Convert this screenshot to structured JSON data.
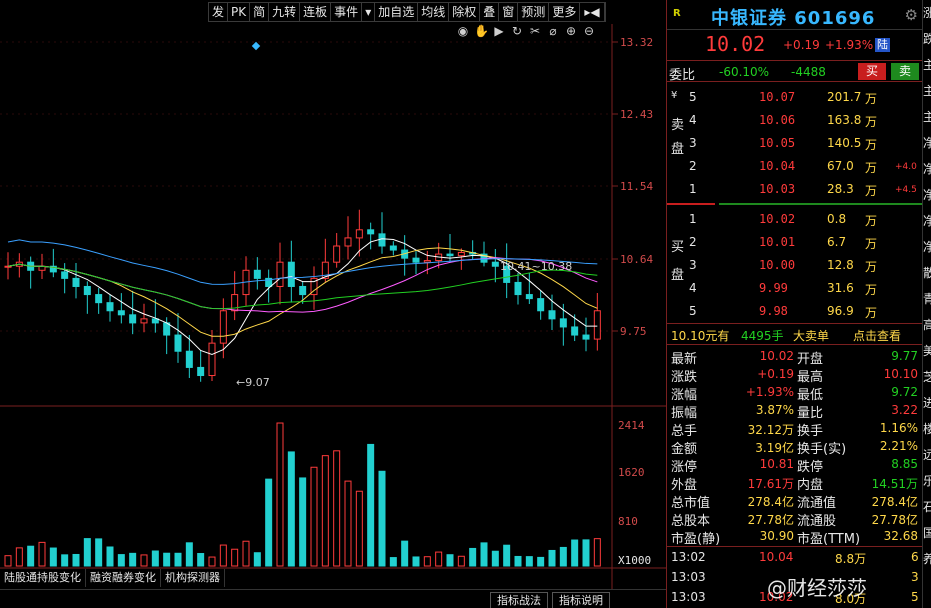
{
  "toolbar": [
    "发",
    "PK",
    "简",
    "九转",
    "连板",
    "事件",
    "▾",
    "加自选",
    "均线",
    "除权",
    "叠",
    "窗",
    "预测",
    "更多",
    "▸◀"
  ],
  "chart": {
    "price_labels": [
      "13.32",
      "12.43",
      "11.54",
      "10.64",
      "9.75"
    ],
    "volume_labels": [
      "2414",
      "1620",
      "810",
      "X1000"
    ],
    "low_annotation": "9.07",
    "range_annotation": "10.41~10.38"
  },
  "bottom_tabs": [
    "陆股通持股变化",
    "融资融券变化",
    "机构探测器"
  ],
  "bottom_buttons": [
    "指标战法",
    "指标说明"
  ],
  "stock": {
    "badge": "R",
    "title": "中银证券 601696",
    "price": "10.02",
    "change": "+0.19",
    "change_pct": "+1.93%",
    "market_tag": "陆",
    "weibi_label": "委比",
    "weibi": "-60.10%",
    "weicha": "-4488",
    "buy_label": "买",
    "sell_label": "卖"
  },
  "asks": [
    {
      "lvl": "5",
      "price": "10.07",
      "qty": "201.7",
      "unit": "万",
      "delta": ""
    },
    {
      "lvl": "4",
      "price": "10.06",
      "qty": "163.8",
      "unit": "万",
      "delta": ""
    },
    {
      "lvl": "3",
      "price": "10.05",
      "qty": "140.5",
      "unit": "万",
      "delta": ""
    },
    {
      "lvl": "2",
      "price": "10.04",
      "qty": "67.0",
      "unit": "万",
      "delta": "+4.0"
    },
    {
      "lvl": "1",
      "price": "10.03",
      "qty": "28.3",
      "unit": "万",
      "delta": "+4.5"
    }
  ],
  "ask_side": [
    "¥",
    "卖",
    "盘"
  ],
  "bids": [
    {
      "lvl": "1",
      "price": "10.02",
      "qty": "0.8",
      "unit": "万"
    },
    {
      "lvl": "2",
      "price": "10.01",
      "qty": "6.7",
      "unit": "万"
    },
    {
      "lvl": "3",
      "price": "10.00",
      "qty": "12.8",
      "unit": "万"
    },
    {
      "lvl": "4",
      "price": "9.99",
      "qty": "31.6",
      "unit": "万"
    },
    {
      "lvl": "5",
      "price": "9.98",
      "qty": "96.9",
      "unit": "万"
    }
  ],
  "bid_side": [
    "买",
    "盘"
  ],
  "summary": {
    "a": "10.10元有",
    "b": "4495手",
    "c": "大卖单",
    "d": "点击查看"
  },
  "stats": [
    {
      "k1": "最新",
      "v1": "10.02",
      "c1": "red",
      "k2": "开盘",
      "v2": "9.77",
      "c2": "green"
    },
    {
      "k1": "涨跌",
      "v1": "+0.19",
      "c1": "red",
      "k2": "最高",
      "v2": "10.10",
      "c2": "red"
    },
    {
      "k1": "涨幅",
      "v1": "+1.93%",
      "c1": "red",
      "k2": "最低",
      "v2": "9.72",
      "c2": "green"
    },
    {
      "k1": "振幅",
      "v1": "3.87%",
      "c1": "yellow",
      "k2": "量比",
      "v2": "3.22",
      "c2": "red"
    },
    {
      "k1": "总手",
      "v1": "32.12万",
      "c1": "yellow",
      "k2": "换手",
      "v2": "1.16%",
      "c2": "yellow"
    },
    {
      "k1": "金额",
      "v1": "3.19亿",
      "c1": "yellow",
      "k2": "换手(实)",
      "v2": "2.21%",
      "c2": "yellow"
    },
    {
      "k1": "涨停",
      "v1": "10.81",
      "c1": "red",
      "k2": "跌停",
      "v2": "8.85",
      "c2": "green"
    },
    {
      "k1": "外盘",
      "v1": "17.61万",
      "c1": "red",
      "k2": "内盘",
      "v2": "14.51万",
      "c2": "green"
    },
    {
      "k1": "总市值",
      "v1": "278.4亿",
      "c1": "yellow",
      "k2": "流通值",
      "v2": "278.4亿",
      "c2": "yellow"
    },
    {
      "k1": "总股本",
      "v1": "27.78亿",
      "c1": "yellow",
      "k2": "流通股",
      "v2": "27.78亿",
      "c2": "yellow"
    },
    {
      "k1": "市盈(静)",
      "v1": "30.90",
      "c1": "yellow",
      "k2": "市盈(TTM)",
      "v2": "32.68",
      "c2": "yellow"
    }
  ],
  "ticks": [
    {
      "t": "13:02",
      "p": "10.04",
      "q": "8.8万",
      "n": "6"
    },
    {
      "t": "13:03",
      "p": "",
      "q": "",
      "n": "3"
    },
    {
      "t": "13:03",
      "p": "10.02",
      "q": "8.0万",
      "n": "5"
    }
  ],
  "watermark": "@财经莎莎",
  "edge_chars": [
    "涨",
    "跌",
    "主",
    "主",
    "主",
    "净",
    "净",
    "净",
    "净",
    "净",
    "散",
    "青",
    "高",
    "美",
    "芝",
    "进",
    "楼",
    "远",
    "乐",
    "石",
    "国",
    "养"
  ],
  "colors": {
    "up": "#ff3b3b",
    "down": "#22d0d0",
    "ma5": "#ffffff",
    "ma10": "#ffd84a",
    "ma20": "#ff5cff",
    "ma30": "#22d022",
    "ma60": "#3aa0ff",
    "ma120": "#aaaaaa"
  }
}
